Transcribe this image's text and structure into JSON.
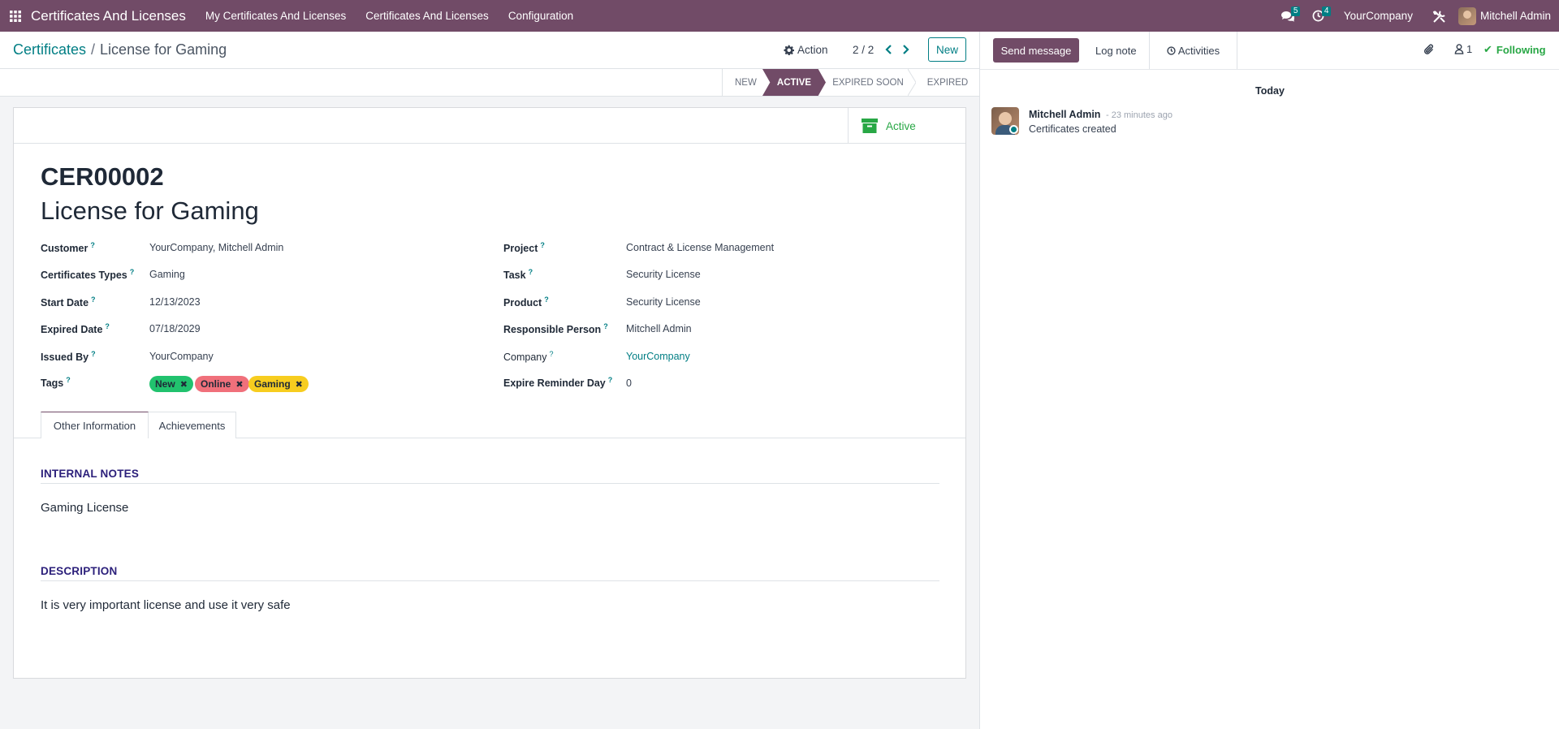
{
  "navbar": {
    "brand": "Certificates And Licenses",
    "menu": [
      "My Certificates And Licenses",
      "Certificates And Licenses",
      "Configuration"
    ],
    "messages_badge": "5",
    "activities_badge": "4",
    "company": "YourCompany",
    "user": "Mitchell Admin",
    "bg_color": "#714b67"
  },
  "control_panel": {
    "breadcrumb_parent": "Certificates",
    "breadcrumb_sep": "/",
    "breadcrumb_current": "License for Gaming",
    "action_label": "Action",
    "pager": "2 / 2",
    "new_label": "New"
  },
  "statusbar": {
    "stages": [
      "NEW",
      "ACTIVE",
      "EXPIRED SOON",
      "EXPIRED"
    ],
    "current": "ACTIVE"
  },
  "form": {
    "active_button": "Active",
    "code": "CER00002",
    "name": "License for Gaming",
    "left_fields": [
      {
        "label": "Customer",
        "value": "YourCompany, Mitchell Admin"
      },
      {
        "label": "Certificates Types",
        "value": "Gaming"
      },
      {
        "label": "Start Date",
        "value": "12/13/2023"
      },
      {
        "label": "Expired Date",
        "value": "07/18/2029"
      },
      {
        "label": "Issued By",
        "value": "YourCompany"
      },
      {
        "label": "Tags",
        "value": ""
      }
    ],
    "right_fields": [
      {
        "label": "Project",
        "value": "Contract & License Management"
      },
      {
        "label": "Task",
        "value": "Security License"
      },
      {
        "label": "Product",
        "value": "Security License"
      },
      {
        "label": "Responsible Person",
        "value": "Mitchell Admin"
      },
      {
        "label": "Company",
        "value": "YourCompany"
      },
      {
        "label": "Expire Reminder Day",
        "value": "0"
      }
    ],
    "tags": [
      {
        "label": "New",
        "color": "#21c26e"
      },
      {
        "label": "Online",
        "color": "#f0707b"
      },
      {
        "label": "Gaming",
        "color": "#f7cd1f"
      }
    ],
    "tabs": [
      "Other Information",
      "Achievements"
    ],
    "internal_notes_title": "INTERNAL NOTES",
    "internal_notes": "Gaming License",
    "description_title": "DESCRIPTION",
    "description": "It is very important license and use it very safe"
  },
  "chatter": {
    "send_message": "Send message",
    "log_note": "Log note",
    "activities": "Activities",
    "followers_count": "1",
    "following": "Following",
    "today": "Today",
    "message": {
      "author": "Mitchell Admin",
      "time": "- 23 minutes ago",
      "body": "Certificates created"
    }
  }
}
